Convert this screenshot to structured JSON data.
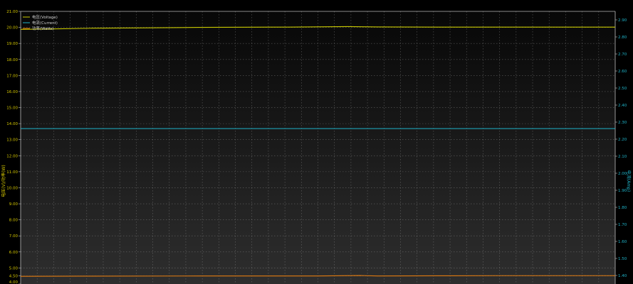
{
  "chart_data": {
    "type": "line",
    "left_axis": {
      "label": "电压(V)/功率(W)",
      "ticks": [
        "4.00",
        "4.50",
        "5.00",
        "6.00",
        "7.00",
        "8.00",
        "9.00",
        "10.00",
        "11.00",
        "12.00",
        "13.00",
        "14.00",
        "15.00",
        "16.00",
        "17.00",
        "18.00",
        "19.00",
        "20.00",
        "21.00"
      ],
      "range": [
        4.0,
        21.0
      ]
    },
    "right_axis": {
      "label": "电流(Amp)",
      "ticks": [
        "1.40",
        "1.50",
        "1.60",
        "1.70",
        "1.80",
        "1.90",
        "2.00",
        "2.10",
        "2.20",
        "2.30",
        "2.40",
        "2.50",
        "2.60",
        "2.70",
        "2.80",
        "2.90"
      ],
      "range": [
        1.35,
        2.95
      ]
    },
    "legend": {
      "placement": "top-left",
      "entries": [
        "电压(Voltage)",
        "电流(Current)",
        "功率(Watts)"
      ]
    },
    "series": [
      {
        "name": "电压(Voltage)",
        "axis": "left",
        "color": "#c8c800",
        "x": [
          0,
          0.05,
          0.12,
          0.2,
          0.3,
          0.45,
          0.55,
          0.6,
          0.7,
          0.8,
          0.9,
          1.0
        ],
        "values": [
          19.88,
          19.9,
          19.95,
          19.97,
          20.0,
          20.02,
          20.05,
          20.03,
          20.02,
          20.02,
          20.02,
          20.02
        ]
      },
      {
        "name": "电流(Current)",
        "axis": "right",
        "color": "#1fb3c8",
        "x": [
          0,
          1.0
        ],
        "values": [
          2.262,
          2.262
        ]
      },
      {
        "name": "功率(Watts)",
        "axis": "left",
        "color": "#e07a10",
        "x": [
          0,
          0.1,
          0.3,
          0.5,
          0.57,
          0.6,
          0.7,
          0.8,
          1.0
        ],
        "values": [
          4.48,
          4.49,
          4.5,
          4.5,
          4.53,
          4.5,
          4.51,
          4.52,
          4.52
        ]
      }
    ],
    "grid": true,
    "colors": {
      "left_axis": "#d6c800",
      "right_axis": "#1fb3c8",
      "grid": "#9a9a9a"
    }
  }
}
